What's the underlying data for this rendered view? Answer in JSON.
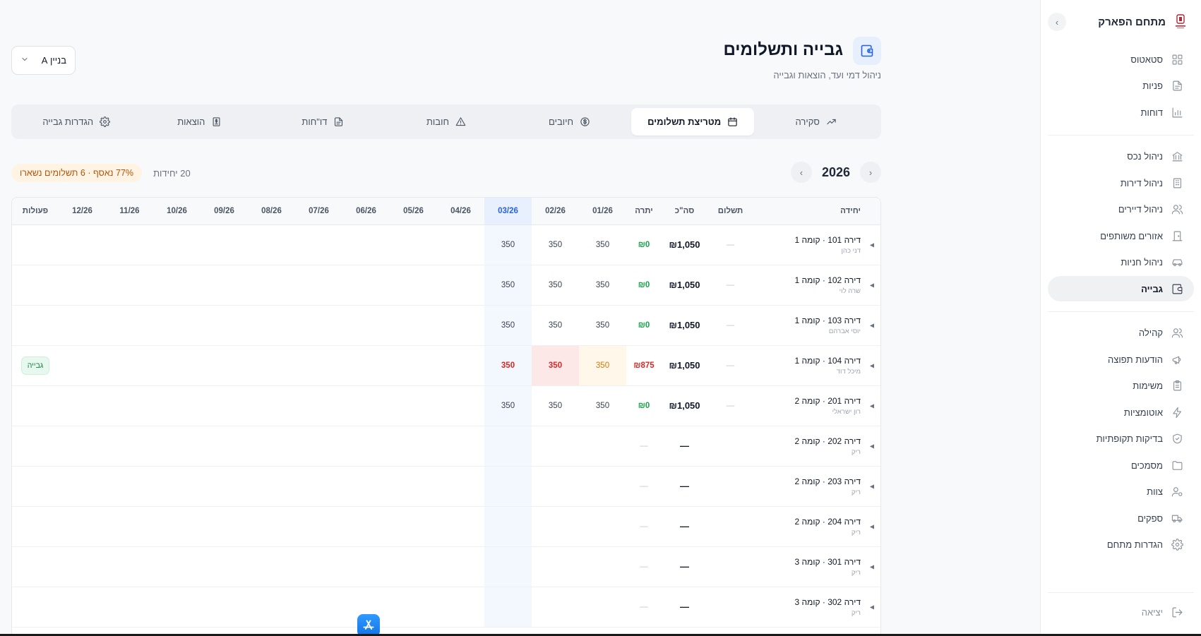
{
  "sidebar": {
    "title": "מתחם הפארק",
    "collapse_icon": "chevron-right-icon",
    "groups": [
      [
        {
          "label": "סטאטוס",
          "icon": "grid-icon"
        },
        {
          "label": "פניות",
          "icon": "document-icon"
        },
        {
          "label": "דוחות",
          "icon": "bar-chart-icon"
        }
      ],
      [
        {
          "label": "ניהול נכס",
          "icon": "bank-icon"
        },
        {
          "label": "ניהול דירות",
          "icon": "building-icon"
        },
        {
          "label": "ניהול דיירים",
          "icon": "users-icon"
        },
        {
          "label": "אזורים משותפים",
          "icon": "door-icon"
        },
        {
          "label": "ניהול חניות",
          "icon": "car-icon"
        },
        {
          "label": "גבייה",
          "icon": "wallet-icon",
          "active": true
        }
      ],
      [
        {
          "label": "קהילה",
          "icon": "users-icon"
        },
        {
          "label": "הודעות תפוצה",
          "icon": "megaphone-icon"
        },
        {
          "label": "משימות",
          "icon": "clipboard-icon"
        },
        {
          "label": "אוטומציות",
          "icon": "lightning-icon"
        },
        {
          "label": "בדיקות תקופתיות",
          "icon": "shield-check-icon"
        },
        {
          "label": "מסמכים",
          "icon": "folder-icon"
        },
        {
          "label": "צוות",
          "icon": "user-gear-icon"
        },
        {
          "label": "ספקים",
          "icon": "truck-icon"
        },
        {
          "label": "הגדרות מתחם",
          "icon": "gear-icon"
        }
      ]
    ],
    "logout": {
      "label": "יציאה",
      "icon": "logout-icon"
    }
  },
  "header": {
    "title": "גבייה ותשלומים",
    "subtitle": "ניהול דמי ועד, הוצאות וגבייה",
    "icon": "wallet-icon",
    "building_select": "בניין A"
  },
  "tabs": [
    {
      "label": "סקירה",
      "icon": "trending-up-icon"
    },
    {
      "label": "מטריצת תשלומים",
      "icon": "calendar-icon",
      "active": true
    },
    {
      "label": "חיובים",
      "icon": "dollar-circle-icon"
    },
    {
      "label": "חובות",
      "icon": "warning-icon"
    },
    {
      "label": "דו\"חות",
      "icon": "document-icon"
    },
    {
      "label": "הוצאות",
      "icon": "receipt-icon"
    },
    {
      "label": "הגדרות גבייה",
      "icon": "gear-icon"
    }
  ],
  "matrix": {
    "year": "2026",
    "units_count": "20 יחידות",
    "collected_badge": "77% נאסף · 6 תשלומים נשארו",
    "headers": {
      "unit": "יחידה",
      "payment": "תשלום",
      "total": "סה\"כ",
      "balance": "יתרה",
      "actions": "פעולות",
      "months": [
        "01/26",
        "02/26",
        "03/26",
        "04/26",
        "05/26",
        "06/26",
        "07/26",
        "08/26",
        "09/26",
        "10/26",
        "11/26",
        "12/26"
      ],
      "current_month_index": 2
    },
    "rows": [
      {
        "unit": "דירה 101 · קומה 1",
        "tenant": "דני כהן",
        "payment": "—",
        "total": "₪1,050",
        "balance": "₪0",
        "balance_status": "ok",
        "months": [
          "350",
          "350",
          "350"
        ],
        "month_status": [
          "",
          "",
          ""
        ],
        "action": ""
      },
      {
        "unit": "דירה 102 · קומה 1",
        "tenant": "שרה לוי",
        "payment": "—",
        "total": "₪1,050",
        "balance": "₪0",
        "balance_status": "ok",
        "months": [
          "350",
          "350",
          "350"
        ],
        "month_status": [
          "",
          "",
          ""
        ],
        "action": ""
      },
      {
        "unit": "דירה 103 · קומה 1",
        "tenant": "יוסי אברהם",
        "payment": "—",
        "total": "₪1,050",
        "balance": "₪0",
        "balance_status": "ok",
        "months": [
          "350",
          "350",
          "350"
        ],
        "month_status": [
          "",
          "",
          ""
        ],
        "action": ""
      },
      {
        "unit": "דירה 104 · קומה 1",
        "tenant": "מיכל דוד",
        "payment": "—",
        "total": "₪1,050",
        "balance": "₪875",
        "balance_status": "debt",
        "months": [
          "350",
          "350",
          "350"
        ],
        "month_status": [
          "warn",
          "bad",
          "red"
        ],
        "action": "גבייה"
      },
      {
        "unit": "דירה 201 · קומה 2",
        "tenant": "רון ישראלי",
        "payment": "—",
        "total": "₪1,050",
        "balance": "₪0",
        "balance_status": "ok",
        "months": [
          "350",
          "350",
          "350"
        ],
        "month_status": [
          "",
          "",
          ""
        ],
        "action": ""
      },
      {
        "unit": "דירה 202 · קומה 2",
        "tenant": "ריק",
        "payment": "",
        "total": "—",
        "balance": "—",
        "balance_status": "empty",
        "months": [
          "",
          "",
          ""
        ],
        "month_status": [
          "",
          "",
          ""
        ],
        "action": ""
      },
      {
        "unit": "דירה 203 · קומה 2",
        "tenant": "ריק",
        "payment": "",
        "total": "—",
        "balance": "—",
        "balance_status": "empty",
        "months": [
          "",
          "",
          ""
        ],
        "month_status": [
          "",
          "",
          ""
        ],
        "action": ""
      },
      {
        "unit": "דירה 204 · קומה 2",
        "tenant": "ריק",
        "payment": "",
        "total": "—",
        "balance": "—",
        "balance_status": "empty",
        "months": [
          "",
          "",
          ""
        ],
        "month_status": [
          "",
          "",
          ""
        ],
        "action": ""
      },
      {
        "unit": "דירה 301 · קומה 3",
        "tenant": "ריק",
        "payment": "",
        "total": "—",
        "balance": "—",
        "balance_status": "empty",
        "months": [
          "",
          "",
          ""
        ],
        "month_status": [
          "",
          "",
          ""
        ],
        "action": ""
      },
      {
        "unit": "דירה 302 · קומה 3",
        "tenant": "ריק",
        "payment": "",
        "total": "—",
        "balance": "—",
        "balance_status": "empty",
        "months": [
          "",
          "",
          ""
        ],
        "month_status": [
          "",
          "",
          ""
        ],
        "action": ""
      }
    ]
  },
  "colors": {
    "accent": "#2563eb",
    "success": "#16a34a",
    "danger": "#dc2626",
    "warning": "#d97706"
  }
}
